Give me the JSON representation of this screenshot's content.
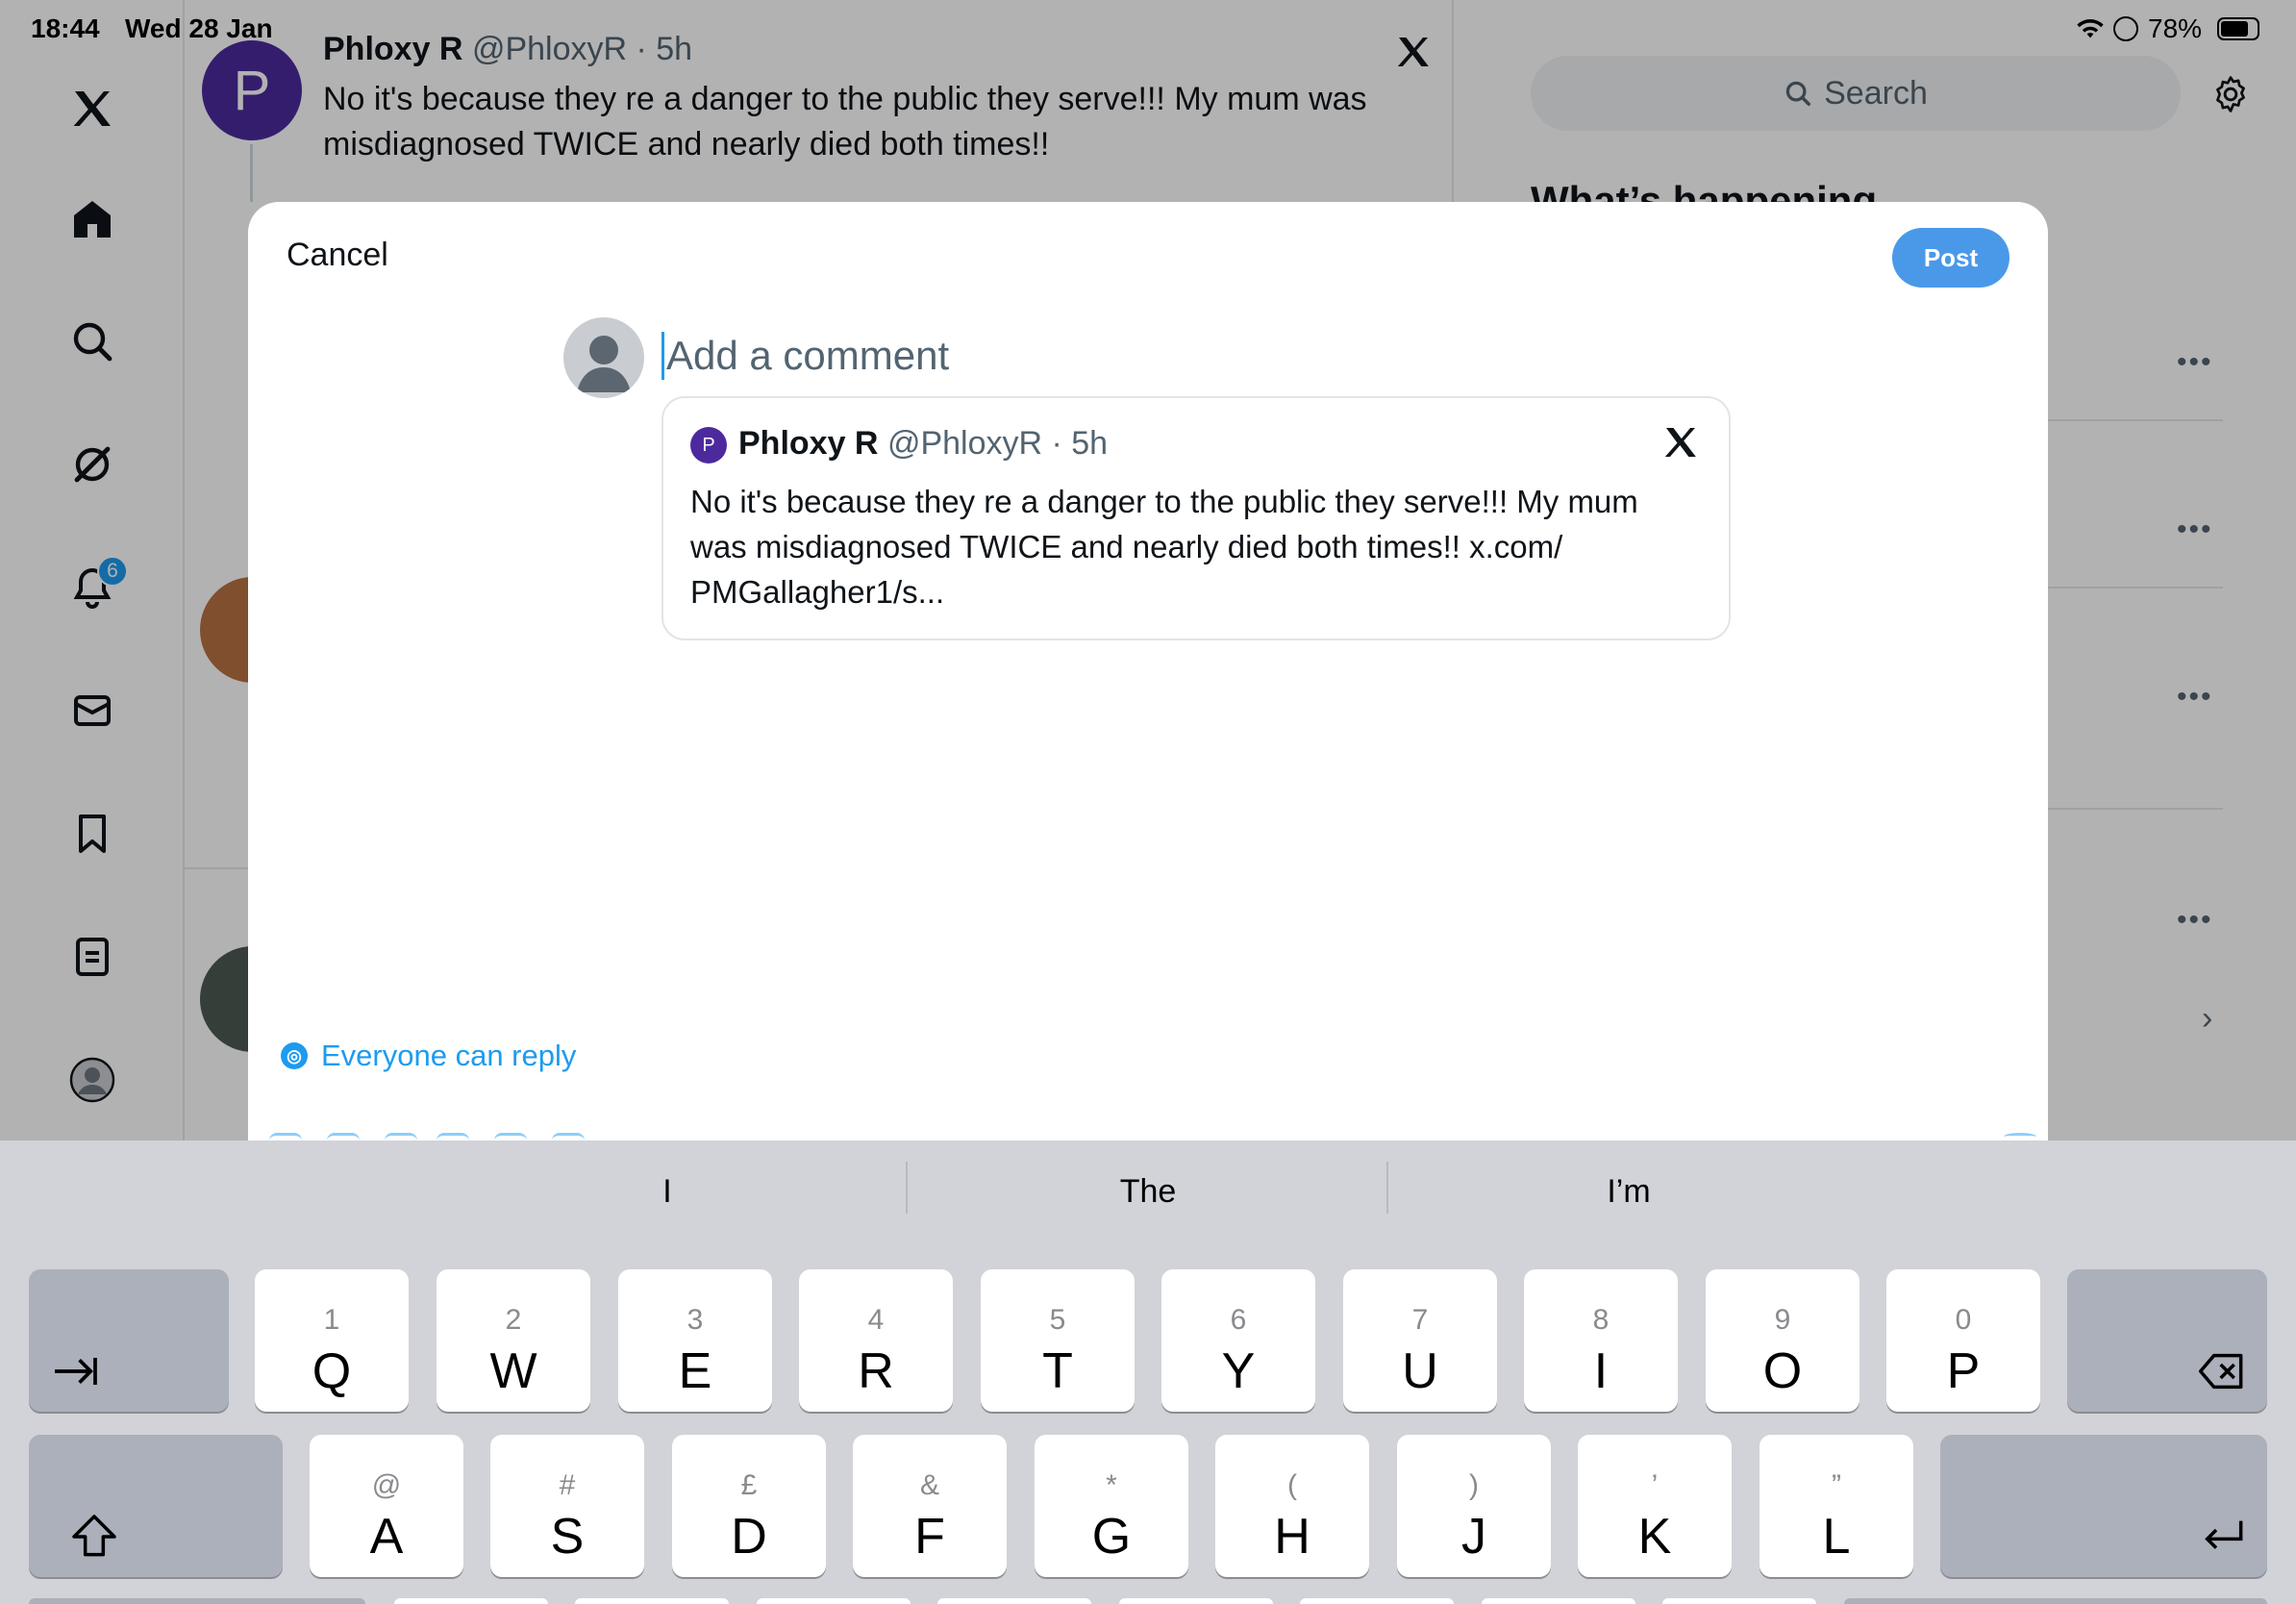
{
  "status_bar": {
    "time": "18:44",
    "date": "Wed 28 Jan",
    "battery": "78%"
  },
  "sidebar": {
    "items": [
      {
        "name": "x-logo",
        "icon": "x-logo-icon"
      },
      {
        "name": "home",
        "icon": "home-icon"
      },
      {
        "name": "explore",
        "icon": "search-icon"
      },
      {
        "name": "grok",
        "icon": "grok-icon"
      },
      {
        "name": "notifications",
        "icon": "bell-icon",
        "badge": "6"
      },
      {
        "name": "messages",
        "icon": "mail-icon"
      },
      {
        "name": "bookmarks",
        "icon": "bookmark-icon"
      },
      {
        "name": "lists",
        "icon": "list-icon"
      },
      {
        "name": "profile",
        "icon": "avatar-icon"
      }
    ]
  },
  "background_post": {
    "avatar_letter": "P",
    "author": "Phloxy R",
    "meta": "@PhloxyR · 5h",
    "text": "No it's because they re a danger to the public they serve!!! My mum was misdiagnosed TWICE and nearly died both times!!"
  },
  "right_column": {
    "search_placeholder": "Search",
    "heading": "What’s happening"
  },
  "modal": {
    "cancel_label": "Cancel",
    "post_label": "Post",
    "composer_placeholder": "Add a comment",
    "quote": {
      "avatar_letter": "P",
      "author": "Phloxy R",
      "meta": "@PhloxyR · 5h",
      "text": "No it's because they re a danger to the public they serve!!! My mum was misdiagnosed TWICE and nearly died both times!! x.com/ PMGallagher1/s..."
    },
    "reply_setting": "Everyone can reply"
  },
  "keyboard": {
    "suggestions": [
      "I",
      "The",
      "I’m"
    ],
    "row1": [
      {
        "sub": "1",
        "main": "Q"
      },
      {
        "sub": "2",
        "main": "W"
      },
      {
        "sub": "3",
        "main": "E"
      },
      {
        "sub": "4",
        "main": "R"
      },
      {
        "sub": "5",
        "main": "T"
      },
      {
        "sub": "6",
        "main": "Y"
      },
      {
        "sub": "7",
        "main": "U"
      },
      {
        "sub": "8",
        "main": "I"
      },
      {
        "sub": "9",
        "main": "O"
      },
      {
        "sub": "0",
        "main": "P"
      }
    ],
    "row2": [
      {
        "sub": "@",
        "main": "A"
      },
      {
        "sub": "#",
        "main": "S"
      },
      {
        "sub": "£",
        "main": "D"
      },
      {
        "sub": "&",
        "main": "F"
      },
      {
        "sub": "*",
        "main": "G"
      },
      {
        "sub": "(",
        "main": "H"
      },
      {
        "sub": ")",
        "main": "J"
      },
      {
        "sub": "’",
        "main": "K"
      },
      {
        "sub": "”",
        "main": "L"
      }
    ]
  },
  "colors": {
    "accent": "#1d9bf0",
    "post_button": "#4a99e9",
    "keyboard_bg": "#d1d3d9",
    "function_key": "#abb0ba"
  }
}
